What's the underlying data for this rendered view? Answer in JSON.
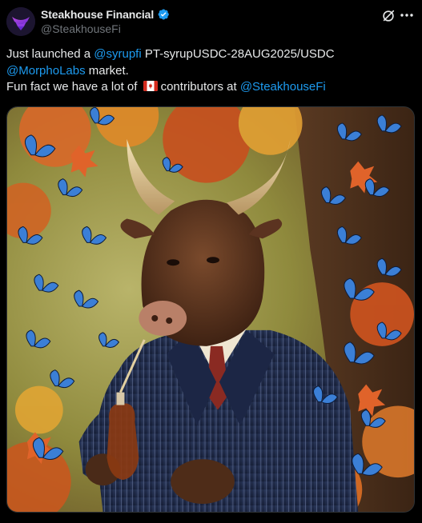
{
  "header": {
    "display_name": "Steakhouse Financial",
    "handle": "@SteakhouseFi",
    "avatar_icon": "steakhouse-logo-icon",
    "verified_icon": "verified-badge-icon",
    "grok_icon": "grok-icon",
    "more_icon": "more-icon"
  },
  "tweet": {
    "line1_prefix": "Just launched a ",
    "mention_syrupfi": "@syrupfi",
    "line1_suffix": "  PT-syrupUSDC-28AUG2025/USDC",
    "mention_morpholabs": "@MorphoLabs",
    "line2_suffix": " market.",
    "line3_prefix": "Fun fact we have a lot of ",
    "line3_middle": "contributors at ",
    "mention_steakhousefi": "@SteakhouseFi"
  },
  "media": {
    "type": "painting",
    "subject": "bull in pinstripe suit drinking from maple syrup jug, blue butterflies and autumn maple leaves"
  },
  "colors": {
    "background": "#000000",
    "text": "#e7e9ea",
    "secondary": "#71767b",
    "accent": "#1d9bf0",
    "verified": "#1d9bf0"
  }
}
